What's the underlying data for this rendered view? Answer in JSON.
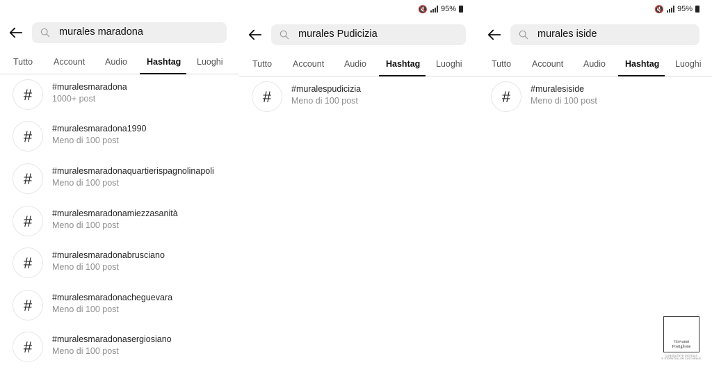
{
  "status": {
    "battery": "95%"
  },
  "tabs": [
    "Tutto",
    "Account",
    "Audio",
    "Hashtag",
    "Luoghi"
  ],
  "panels": [
    {
      "query": "murales maradona",
      "results": [
        {
          "tag": "#muralesmaradona",
          "count": "1000+ post"
        },
        {
          "tag": "#muralesmaradona1990",
          "count": "Meno di 100 post"
        },
        {
          "tag": "#muralesmaradonaquartierispagnolinapoli",
          "count": "Meno di 100 post"
        },
        {
          "tag": "#muralesmaradonamiezzasanità",
          "count": "Meno di 100 post"
        },
        {
          "tag": "#muralesmaradonabrusciano",
          "count": "Meno di 100 post"
        },
        {
          "tag": "#muralesmaradonacheguevara",
          "count": "Meno di 100 post"
        },
        {
          "tag": "#muralesmaradonasergiosiano",
          "count": "Meno di 100 post"
        }
      ]
    },
    {
      "query": "murales Pudicizia",
      "results": [
        {
          "tag": "#muralespudicizia",
          "count": "Meno di 100 post"
        }
      ]
    },
    {
      "query": "murales iside",
      "results": [
        {
          "tag": "#muralesiside",
          "count": "Meno di 100 post"
        }
      ]
    }
  ],
  "watermark": {
    "name_line1": "Giovanni",
    "name_line2": "Postiglione",
    "caption_line1": "CONSULENTE DIGITALE",
    "caption_line2": "E STORYTELLER CULTURALE"
  }
}
